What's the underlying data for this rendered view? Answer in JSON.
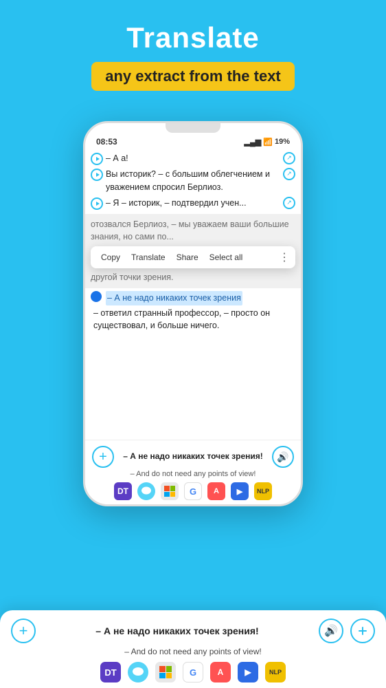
{
  "header": {
    "title": "Translate",
    "subtitle": "any extract from the text"
  },
  "status_bar": {
    "time": "08:53",
    "battery": "19%",
    "signal": "▂▄▆"
  },
  "reading_lines": [
    {
      "id": 1,
      "text": "– А а!"
    },
    {
      "id": 2,
      "text": "Вы историк? – с большим облегчением и уважением спросил Берлиоз."
    },
    {
      "id": 3,
      "text": "– Я – историк, – подтвердил учен"
    },
    {
      "id": 4,
      "text": "отозвался Берлиоз, – мы уважаем ваши большие знания, но сами по"
    }
  ],
  "context_menu": {
    "copy": "Copy",
    "translate": "Translate",
    "share": "Share",
    "select_all": "Select all",
    "more": "⋮"
  },
  "selected_text": {
    "highlighted": "– А не надо никаких точек зрения",
    "continuation": "– ответил странный профессор, – просто он существовал, и больше ничего."
  },
  "bottom_panel": {
    "original": "– А не надо никаких точек зрения!",
    "translated": "– And do not need any points of view!",
    "add_label": "+",
    "speaker_label": "🔊"
  },
  "app_icons": [
    {
      "id": "dt",
      "label": "DT",
      "color": "#5b3cc4"
    },
    {
      "id": "bubble",
      "label": "💬",
      "color": "#55d4f7"
    },
    {
      "id": "ms",
      "label": "ms",
      "color": "#e8e8e8"
    },
    {
      "id": "google",
      "label": "G",
      "color": "#4285f4"
    },
    {
      "id": "az",
      "label": "A",
      "color": "#ff5252"
    },
    {
      "id": "arrow",
      "label": "▶",
      "color": "#2d6be4"
    },
    {
      "id": "nlp",
      "label": "NLP",
      "color": "#f0c000"
    }
  ],
  "duplicate_panel": {
    "original": "– А не надо никаких точек зрения!",
    "translated": "– And do not need any points of view!"
  }
}
